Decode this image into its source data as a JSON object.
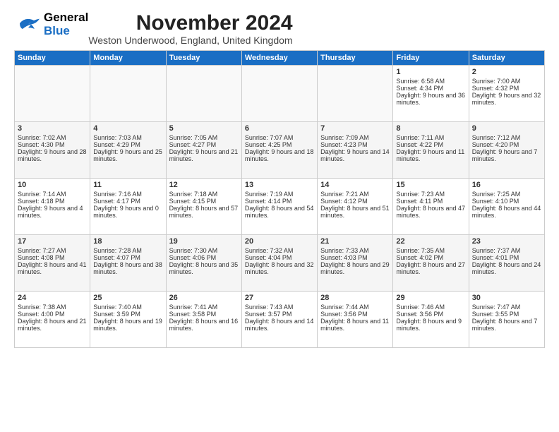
{
  "header": {
    "logo_general": "General",
    "logo_blue": "Blue",
    "title": "November 2024",
    "subtitle": "Weston Underwood, England, United Kingdom"
  },
  "columns": [
    "Sunday",
    "Monday",
    "Tuesday",
    "Wednesday",
    "Thursday",
    "Friday",
    "Saturday"
  ],
  "weeks": [
    [
      {
        "day": "",
        "info": ""
      },
      {
        "day": "",
        "info": ""
      },
      {
        "day": "",
        "info": ""
      },
      {
        "day": "",
        "info": ""
      },
      {
        "day": "",
        "info": ""
      },
      {
        "day": "1",
        "info": "Sunrise: 6:58 AM\nSunset: 4:34 PM\nDaylight: 9 hours and 36 minutes."
      },
      {
        "day": "2",
        "info": "Sunrise: 7:00 AM\nSunset: 4:32 PM\nDaylight: 9 hours and 32 minutes."
      }
    ],
    [
      {
        "day": "3",
        "info": "Sunrise: 7:02 AM\nSunset: 4:30 PM\nDaylight: 9 hours and 28 minutes."
      },
      {
        "day": "4",
        "info": "Sunrise: 7:03 AM\nSunset: 4:29 PM\nDaylight: 9 hours and 25 minutes."
      },
      {
        "day": "5",
        "info": "Sunrise: 7:05 AM\nSunset: 4:27 PM\nDaylight: 9 hours and 21 minutes."
      },
      {
        "day": "6",
        "info": "Sunrise: 7:07 AM\nSunset: 4:25 PM\nDaylight: 9 hours and 18 minutes."
      },
      {
        "day": "7",
        "info": "Sunrise: 7:09 AM\nSunset: 4:23 PM\nDaylight: 9 hours and 14 minutes."
      },
      {
        "day": "8",
        "info": "Sunrise: 7:11 AM\nSunset: 4:22 PM\nDaylight: 9 hours and 11 minutes."
      },
      {
        "day": "9",
        "info": "Sunrise: 7:12 AM\nSunset: 4:20 PM\nDaylight: 9 hours and 7 minutes."
      }
    ],
    [
      {
        "day": "10",
        "info": "Sunrise: 7:14 AM\nSunset: 4:18 PM\nDaylight: 9 hours and 4 minutes."
      },
      {
        "day": "11",
        "info": "Sunrise: 7:16 AM\nSunset: 4:17 PM\nDaylight: 9 hours and 0 minutes."
      },
      {
        "day": "12",
        "info": "Sunrise: 7:18 AM\nSunset: 4:15 PM\nDaylight: 8 hours and 57 minutes."
      },
      {
        "day": "13",
        "info": "Sunrise: 7:19 AM\nSunset: 4:14 PM\nDaylight: 8 hours and 54 minutes."
      },
      {
        "day": "14",
        "info": "Sunrise: 7:21 AM\nSunset: 4:12 PM\nDaylight: 8 hours and 51 minutes."
      },
      {
        "day": "15",
        "info": "Sunrise: 7:23 AM\nSunset: 4:11 PM\nDaylight: 8 hours and 47 minutes."
      },
      {
        "day": "16",
        "info": "Sunrise: 7:25 AM\nSunset: 4:10 PM\nDaylight: 8 hours and 44 minutes."
      }
    ],
    [
      {
        "day": "17",
        "info": "Sunrise: 7:27 AM\nSunset: 4:08 PM\nDaylight: 8 hours and 41 minutes."
      },
      {
        "day": "18",
        "info": "Sunrise: 7:28 AM\nSunset: 4:07 PM\nDaylight: 8 hours and 38 minutes."
      },
      {
        "day": "19",
        "info": "Sunrise: 7:30 AM\nSunset: 4:06 PM\nDaylight: 8 hours and 35 minutes."
      },
      {
        "day": "20",
        "info": "Sunrise: 7:32 AM\nSunset: 4:04 PM\nDaylight: 8 hours and 32 minutes."
      },
      {
        "day": "21",
        "info": "Sunrise: 7:33 AM\nSunset: 4:03 PM\nDaylight: 8 hours and 29 minutes."
      },
      {
        "day": "22",
        "info": "Sunrise: 7:35 AM\nSunset: 4:02 PM\nDaylight: 8 hours and 27 minutes."
      },
      {
        "day": "23",
        "info": "Sunrise: 7:37 AM\nSunset: 4:01 PM\nDaylight: 8 hours and 24 minutes."
      }
    ],
    [
      {
        "day": "24",
        "info": "Sunrise: 7:38 AM\nSunset: 4:00 PM\nDaylight: 8 hours and 21 minutes."
      },
      {
        "day": "25",
        "info": "Sunrise: 7:40 AM\nSunset: 3:59 PM\nDaylight: 8 hours and 19 minutes."
      },
      {
        "day": "26",
        "info": "Sunrise: 7:41 AM\nSunset: 3:58 PM\nDaylight: 8 hours and 16 minutes."
      },
      {
        "day": "27",
        "info": "Sunrise: 7:43 AM\nSunset: 3:57 PM\nDaylight: 8 hours and 14 minutes."
      },
      {
        "day": "28",
        "info": "Sunrise: 7:44 AM\nSunset: 3:56 PM\nDaylight: 8 hours and 11 minutes."
      },
      {
        "day": "29",
        "info": "Sunrise: 7:46 AM\nSunset: 3:56 PM\nDaylight: 8 hours and 9 minutes."
      },
      {
        "day": "30",
        "info": "Sunrise: 7:47 AM\nSunset: 3:55 PM\nDaylight: 8 hours and 7 minutes."
      }
    ]
  ]
}
